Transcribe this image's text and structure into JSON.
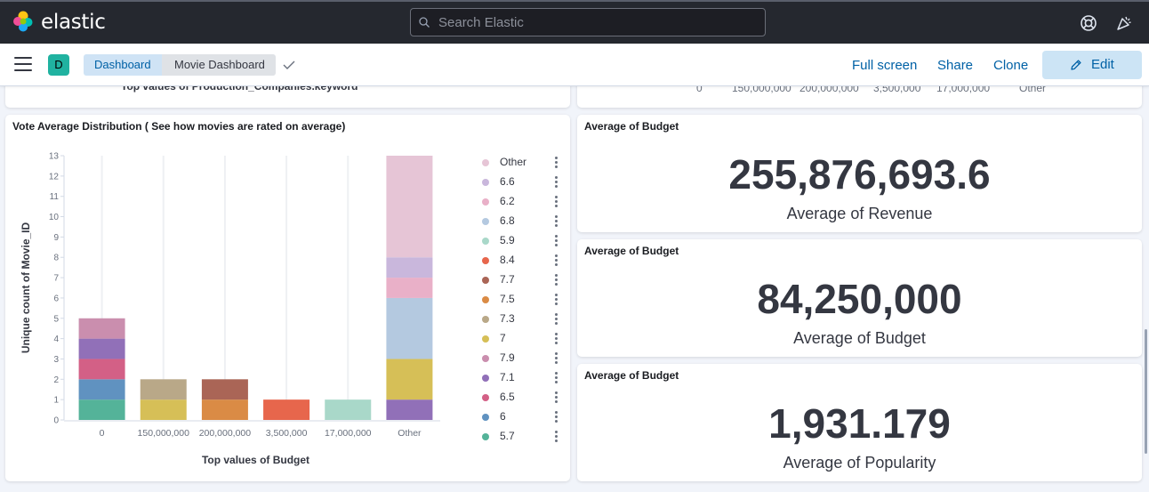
{
  "header": {
    "logo_text": "elastic",
    "search_placeholder": "Search Elastic",
    "help_icon": "help-lifebuoy-icon",
    "news_icon": "newsfeed-icon"
  },
  "nav": {
    "space_initial": "D",
    "breadcrumbs": [
      "Dashboard",
      "Movie Dashboard"
    ],
    "actions": {
      "full_screen": "Full screen",
      "share": "Share",
      "clone": "Clone",
      "edit": "Edit"
    }
  },
  "top_cut": {
    "left_label": "Top values of Production_Companies.keyword",
    "right_ticks": [
      "0",
      "150,000,000",
      "200,000,000",
      "3,500,000",
      "17,000,000",
      "Other"
    ]
  },
  "vote_panel": {
    "title": "Vote Average Distribution ( See how movies are rated on average)"
  },
  "metrics": [
    {
      "title": "Average of Budget",
      "value": "255,876,693.6",
      "label": "Average of Revenue"
    },
    {
      "title": "Average of Budget",
      "value": "84,250,000",
      "label": "Average of Budget"
    },
    {
      "title": "Average of Budget",
      "value": "1,931.179",
      "label": "Average of Popularity"
    }
  ],
  "colors": {
    "accent": "#0061a6",
    "topbar": "#25282f",
    "space_badge": "#20b2a0"
  },
  "chart_data": {
    "type": "bar",
    "stacked": true,
    "xlabel": "Top values of Budget",
    "ylabel": "Unique count of Movie_ID",
    "ylim": [
      0,
      13
    ],
    "yticks": [
      0,
      1,
      2,
      3,
      4,
      5,
      6,
      7,
      8,
      9,
      10,
      11,
      12,
      13
    ],
    "categories": [
      "0",
      "150,000,000",
      "200,000,000",
      "3,500,000",
      "17,000,000",
      "Other"
    ],
    "legend_position": "right",
    "series": [
      {
        "name": "Other",
        "color": "#e6c5d6",
        "values": [
          0,
          0,
          0,
          0,
          0,
          5
        ]
      },
      {
        "name": "6.6",
        "color": "#c9b7dc",
        "values": [
          0,
          0,
          0,
          0,
          0,
          1
        ]
      },
      {
        "name": "6.2",
        "color": "#e9b0c8",
        "values": [
          0,
          0,
          0,
          0,
          0,
          1
        ]
      },
      {
        "name": "6.8",
        "color": "#b4c9e0",
        "values": [
          0,
          0,
          0,
          0,
          0,
          3
        ]
      },
      {
        "name": "5.9",
        "color": "#a9d8c9",
        "values": [
          0,
          0,
          0,
          0,
          1,
          0
        ]
      },
      {
        "name": "8.4",
        "color": "#e7664c",
        "values": [
          0,
          0,
          0,
          1,
          0,
          0
        ]
      },
      {
        "name": "7.7",
        "color": "#aa6556",
        "values": [
          0,
          0,
          1,
          0,
          0,
          0
        ]
      },
      {
        "name": "7.5",
        "color": "#da8b45",
        "values": [
          0,
          0,
          1,
          0,
          0,
          0
        ]
      },
      {
        "name": "7.3",
        "color": "#b9a888",
        "values": [
          0,
          1,
          0,
          0,
          0,
          0
        ]
      },
      {
        "name": "7",
        "color": "#d6bf57",
        "values": [
          0,
          1,
          0,
          0,
          0,
          2
        ]
      },
      {
        "name": "7.9",
        "color": "#ca8eae",
        "values": [
          1,
          0,
          0,
          0,
          0,
          0
        ]
      },
      {
        "name": "7.1",
        "color": "#9170b8",
        "values": [
          1,
          0,
          0,
          0,
          0,
          1
        ]
      },
      {
        "name": "6.5",
        "color": "#d36086",
        "values": [
          1,
          0,
          0,
          0,
          0,
          0
        ]
      },
      {
        "name": "6",
        "color": "#6092c0",
        "values": [
          1,
          0,
          0,
          0,
          0,
          0
        ]
      },
      {
        "name": "5.7",
        "color": "#54b399",
        "values": [
          1,
          0,
          0,
          0,
          0,
          0
        ]
      }
    ]
  }
}
